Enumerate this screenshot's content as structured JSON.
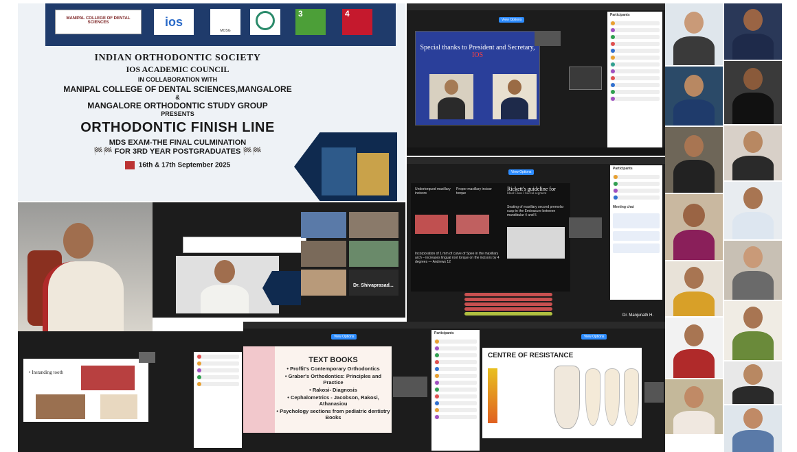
{
  "poster": {
    "logos": [
      "MANIPAL COLLEGE OF DENTAL SCIENCES",
      "ios",
      "MOSG",
      "",
      "3",
      "4"
    ],
    "line1": "INDIAN ORTHODONTIC SOCIETY",
    "line2": "IOS ACADEMIC COUNCIL",
    "line3": "IN COLLABORATION WITH",
    "line4": "MANIPAL COLLEGE OF DENTAL SCIENCES,MANGALORE",
    "line5": "&",
    "line6": "MANGALORE ORTHODONTIC STUDY GROUP",
    "line7": "PRESENTS",
    "title": "ORTHODONTIC FINISH LINE",
    "subtitle1": "MDS EXAM-THE FINAL CULMINATION",
    "subtitle2": "FOR 3RD YEAR POSTGRADUATES",
    "date": "16th & 17th September 2025"
  },
  "thanks_slide": {
    "text": "Special thanks to President and Secretary,",
    "highlight": "IOS"
  },
  "ricketts_slide": {
    "left_label": "Undertorqued maxillary incisors",
    "mid_label": "Proper maxillary incisor torque",
    "right_title": "Rickett's guideline for",
    "right_sub": "Ideal Class I buccal segment",
    "right_body": "Seating of maxillary second premolar cusp in the Embrasure between mandibular 4 and 5",
    "bottom": "Incorporation of 1 mm of curve of Spee in the maxillary arch – increases lingual root torque on the incisors by 4 degrees — Andrews 12"
  },
  "participants_name": "Dr. Manjunath H.",
  "speaker_name": "Dr. Shivaprasad...",
  "crowding_slide": {
    "bullet": "Instanding tooth"
  },
  "textbooks_slide": {
    "title": "TEXT BOOKS",
    "items": [
      "Proffit's Contemporary Orthodontics",
      "Graber's Orthodontics: Principles and Practice",
      "Rakosi- Diagnosis",
      "Cephalometrics - Jacobson, Rakosi, Athanasiou",
      "Psychology sections from pediatric dentistry Books"
    ]
  },
  "resistance_slide": {
    "title": "CENTRE OF RESISTANCE"
  },
  "zoom": {
    "view_btn": "View Options",
    "participants_title": "Participants",
    "chat_title": "Meeting chat"
  },
  "colors": {
    "poster_bg": "#f4f6f8",
    "poster_banner": "#1f3b6b",
    "slide_blue": "#2a3f9a",
    "zoom_dark": "#1c1c1c",
    "accent": "#2d8cff"
  }
}
